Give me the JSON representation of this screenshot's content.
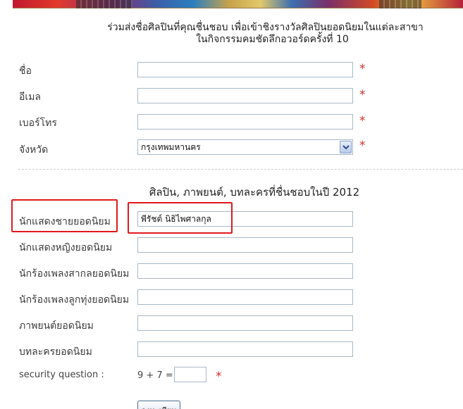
{
  "header": {
    "line1": "ร่วมส่งชื่อศิลปินที่คุณชื่นชอบ เพื่อเข้าชิงรางวัลศิลปินยอดนิยมในแต่ละสาขา",
    "line2": "ในกิจกรรมคมชัดลึกอวอร์ดครั้งที่ 10"
  },
  "personal": {
    "name_label": "ชื่อ",
    "name_value": "",
    "email_label": "อีเมล",
    "email_value": "",
    "phone_label": "เบอร์โทร",
    "phone_value": "",
    "province_label": "จังหวัด",
    "province_selected": "กรุงเทพมหานคร",
    "required_mark": "*"
  },
  "favorites": {
    "title": "ศิลปิน, ภาพยนต์, บทละครที่ชื่นชอบในปี 2012",
    "items": [
      {
        "label": "นักแสดงชายยอดนิยม",
        "value": "พีรัชต์ นิธิไพศาลกุล"
      },
      {
        "label": "นักแสดงหญิงยอดนิยม",
        "value": ""
      },
      {
        "label": "นักร้องเพลงสากลยอดนิยม",
        "value": ""
      },
      {
        "label": "นักร้องเพลงลูกทุ่งยอดนิยม",
        "value": ""
      },
      {
        "label": "ภาพยนต์ยอดนิยม",
        "value": ""
      },
      {
        "label": "บทละครยอดนิยม",
        "value": ""
      }
    ]
  },
  "security": {
    "label": "security question :",
    "question": "9 + 7 =",
    "answer": "",
    "required_mark": "*"
  },
  "submit_label": "ลงทะเบียน",
  "colors": {
    "required": "#d62c2c",
    "highlight": "#e0191f",
    "input_border": "#a9b8c6"
  }
}
